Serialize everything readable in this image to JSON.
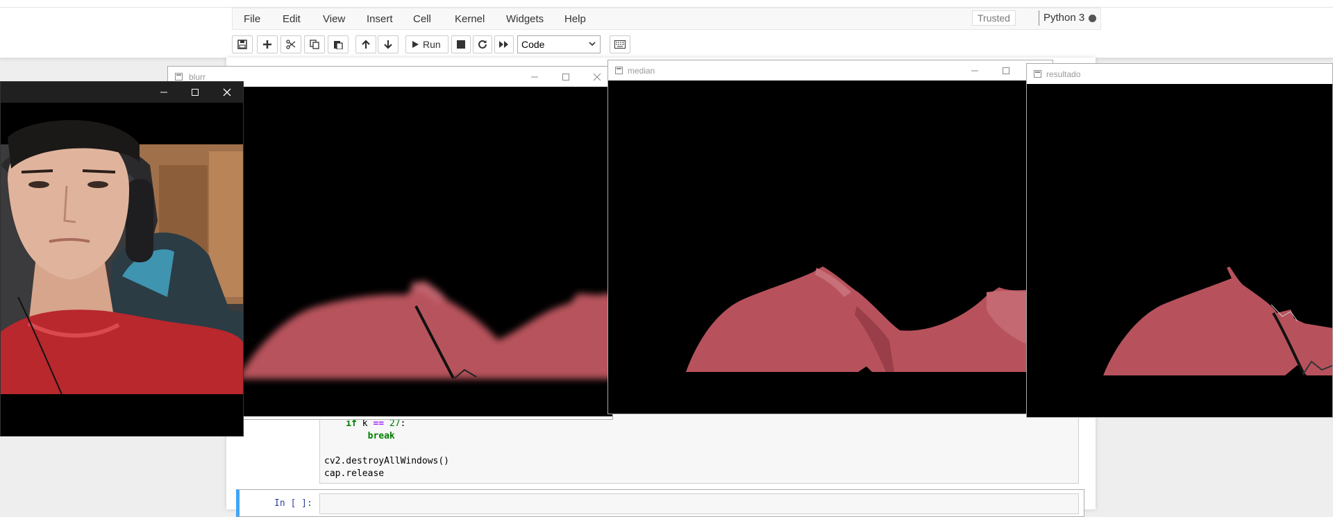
{
  "menubar": {
    "items": [
      "File",
      "Edit",
      "View",
      "Insert",
      "Cell",
      "Kernel",
      "Widgets",
      "Help"
    ]
  },
  "status": {
    "trusted": "Trusted",
    "kernel": "Python 3"
  },
  "toolbar": {
    "run_label": "Run",
    "cell_type": "Code"
  },
  "code": {
    "lines": [
      "    if k == 27:",
      "        break",
      "",
      "cv2.destroyAllWindows()",
      "cap.release"
    ]
  },
  "next_cell": {
    "prompt": "In [ ]:"
  },
  "windows": {
    "blurr": {
      "title": "blurr"
    },
    "median": {
      "title": "median"
    },
    "resultado": {
      "title": "resultado"
    }
  },
  "colors": {
    "mask_shirt": "#b7525c",
    "shirt_original": "#b8282d",
    "kernel_busy": "#555555",
    "active_cell": "#42a5f5"
  }
}
